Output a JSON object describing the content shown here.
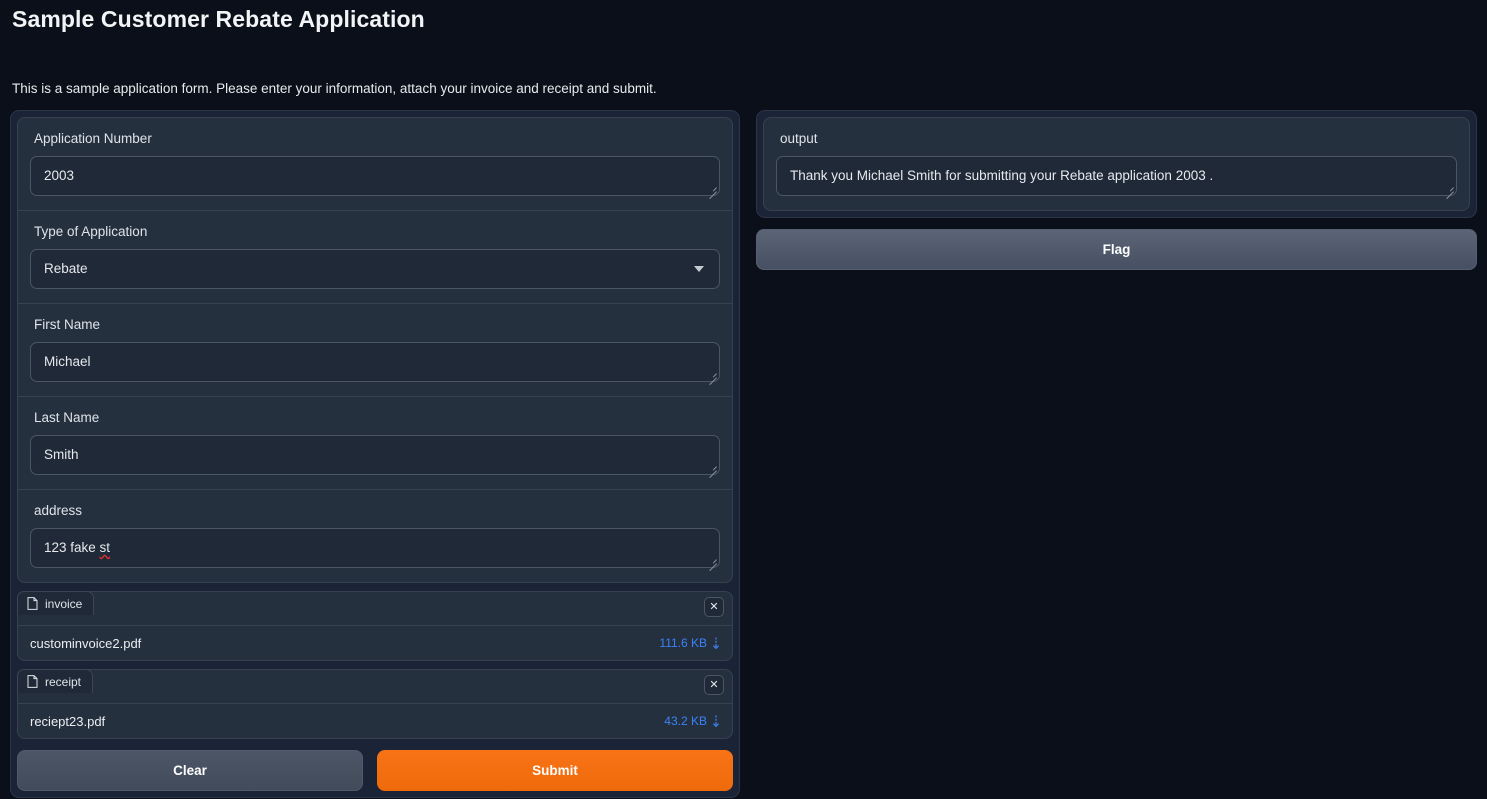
{
  "header": {
    "title": "Sample Customer Rebate Application",
    "description": "This is a sample application form. Please enter your information, attach your invoice and receipt and submit."
  },
  "form": {
    "fields": [
      {
        "label": "Application Number",
        "value": "2003",
        "type": "textarea"
      },
      {
        "label": "Type of Application",
        "value": "Rebate",
        "type": "dropdown"
      },
      {
        "label": "First Name",
        "value": "Michael",
        "type": "textarea"
      },
      {
        "label": "Last Name",
        "value": "Smith",
        "type": "textarea"
      },
      {
        "label": "address",
        "value": "123 fake st",
        "value_ok": "123 fake ",
        "value_misspelled": "st",
        "type": "textarea"
      }
    ],
    "uploads": [
      {
        "tab_label": "invoice",
        "tab_icon": "document-icon",
        "clear_icon": "close-icon",
        "file_name": "custominvoice2.pdf",
        "file_size": "111.6 KB",
        "download_icon": "download-icon"
      },
      {
        "tab_label": "receipt",
        "tab_icon": "document-icon",
        "clear_icon": "close-icon",
        "file_name": "reciept23.pdf",
        "file_size": "43.2 KB",
        "download_icon": "download-icon"
      }
    ],
    "clear_label": "Clear",
    "submit_label": "Submit"
  },
  "output": {
    "label": "output",
    "value": "Thank you Michael Smith for submitting your Rebate application 2003 .",
    "flag_label": "Flag"
  },
  "colors": {
    "background": "#0b0f19",
    "panel": "#25303f",
    "input": "#1f2937",
    "accent_orange": "#f4700b",
    "link_blue": "#3b82f6",
    "spellcheck_red": "#e03131",
    "text_primary": "#e7e9ec"
  }
}
